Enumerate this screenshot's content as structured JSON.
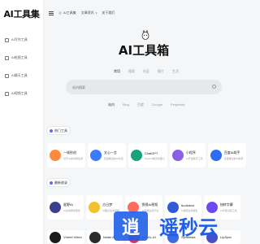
{
  "app": {
    "logo_text": "AI工具集"
  },
  "sidebar": {
    "items": [
      {
        "label": "AI写作工具",
        "icon": "pen-icon"
      },
      {
        "label": "AI绘图工具",
        "icon": "image-icon"
      },
      {
        "label": "AI聊天工具",
        "icon": "chat-icon"
      },
      {
        "label": "AI视频工具",
        "icon": "video-icon"
      }
    ]
  },
  "topbar": {
    "links": [
      {
        "label": "AI工具集"
      },
      {
        "label": "文章资讯"
      },
      {
        "label": "关于我们"
      }
    ]
  },
  "hero": {
    "title": "AI工具箱",
    "tabs": [
      "常用",
      "搜索",
      "社区",
      "图片",
      "生活"
    ],
    "search_placeholder": "站内搜索",
    "engines": [
      "站内",
      "Bing",
      "百度",
      "Google",
      "Perplexity"
    ]
  },
  "sections": [
    {
      "title": "热门工具",
      "cards": [
        {
          "name": "一帧秒创",
          "desc": "基于AI的内容生成",
          "color": "#ff8a3d"
        },
        {
          "name": "文心一言",
          "desc": "百度推出的AI对话",
          "color": "#3b7cff"
        },
        {
          "name": "ChatGPT",
          "desc": "OpenAI聊天机器人",
          "color": "#19a37a"
        },
        {
          "name": "小程序",
          "desc": "AI开发助手工具",
          "color": "#8a60e8"
        },
        {
          "name": "百度AI助手",
          "desc": "百度推出的AI助手",
          "color": "#2e6cf6"
        }
      ]
    },
    {
      "title": "最新收录",
      "cards": [
        {
          "name": "星野AI",
          "desc": "AI虚拟角色陪伴",
          "color": "#3a3f8f"
        },
        {
          "name": "白日梦",
          "desc": "AI图文生成视频",
          "color": "#f2c12e"
        },
        {
          "name": "悦视AI视频",
          "desc": "AI视频生成平台",
          "color": "#ff6b5a"
        },
        {
          "name": "Audiobox",
          "desc": "AI音频生成模型",
          "color": "#2f5bd8"
        },
        {
          "name": "快转字幕",
          "desc": "AI字幕识别工具",
          "color": "#6c4cf2"
        }
      ]
    }
  ],
  "bottom_cards": [
    {
      "name": "Vmeet Video",
      "desc": "",
      "color": "#1c1c1c"
    },
    {
      "name": "Nolan AI",
      "desc": "",
      "color": "#2b2b2b"
    },
    {
      "name": "LALAL.AI",
      "desc": "",
      "color": "#d03a6d"
    },
    {
      "name": "Synthesia",
      "desc": "",
      "color": "#3e6be0"
    },
    {
      "name": "LipSync",
      "desc": "",
      "color": "#4a4fc6"
    }
  ],
  "colors": {
    "accent": "#5b6dee",
    "watermark": "#1f5fe8"
  },
  "watermark": {
    "text": "逍遥秒云"
  }
}
